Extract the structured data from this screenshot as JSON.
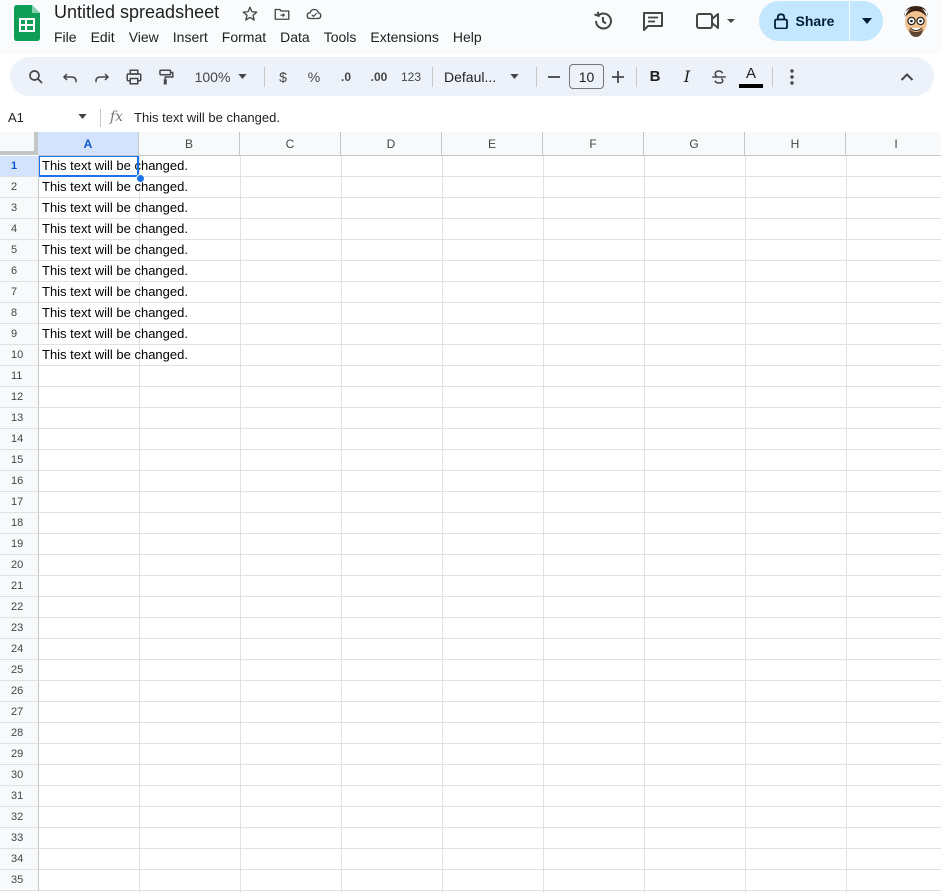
{
  "header": {
    "doc_title": "Untitled spreadsheet",
    "menu": [
      "File",
      "Edit",
      "View",
      "Insert",
      "Format",
      "Data",
      "Tools",
      "Extensions",
      "Help"
    ],
    "share_label": "Share"
  },
  "toolbar": {
    "zoom": "100%",
    "currency": "$",
    "percent": "%",
    "dec_decrease": ".0",
    "dec_increase": ".00",
    "number_format": "123",
    "font": "Defaul...",
    "font_size": "10",
    "bold": "B",
    "italic": "I",
    "text_color": "A"
  },
  "formula_bar": {
    "cell_ref": "A1",
    "fx": "fx",
    "content": "This text will be changed."
  },
  "grid": {
    "columns": [
      "A",
      "B",
      "C",
      "D",
      "E",
      "F",
      "G",
      "H",
      "I"
    ],
    "selected_column": "A",
    "rows": [
      "1",
      "2",
      "3",
      "4",
      "5",
      "6",
      "7",
      "8",
      "9",
      "10",
      "11",
      "12",
      "13",
      "14",
      "15",
      "16",
      "17",
      "18",
      "19",
      "20",
      "21",
      "22",
      "23",
      "24",
      "25",
      "26",
      "27",
      "28",
      "29",
      "30",
      "31",
      "32",
      "33",
      "34",
      "35"
    ],
    "selected_row": "1",
    "cells_col_a": [
      "This text will be changed.",
      "This text will be changed.",
      "This text will be changed.",
      "This text will be changed.",
      "This text will be changed.",
      "This text will be changed.",
      "This text will be changed.",
      "This text will be changed.",
      "This text will be changed.",
      "This text will be changed."
    ]
  },
  "colors": {
    "accent": "#1a73e8",
    "share_bg": "#c2e7ff",
    "toolbar_bg": "#edf2fa",
    "selected_header_bg": "#d3e3fd",
    "sheets_green": "#0f9d58"
  }
}
